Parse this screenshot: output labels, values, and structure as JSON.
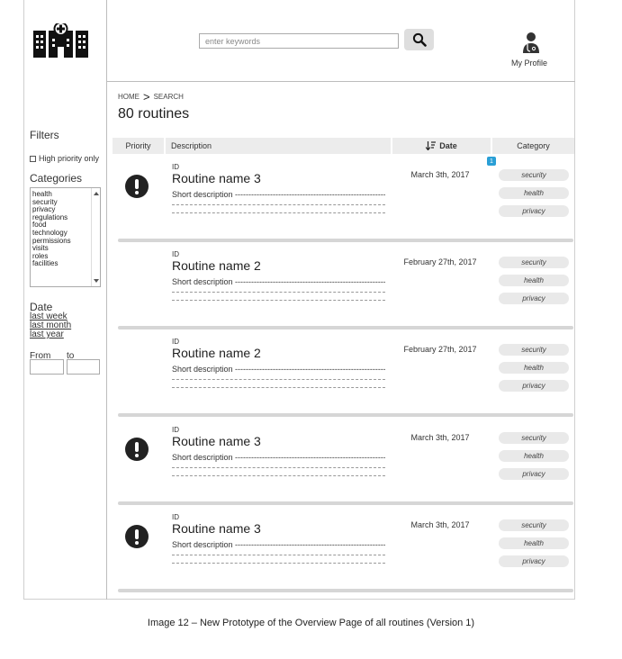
{
  "header": {
    "logo_icon": "hospital-icon",
    "search_placeholder": "enter keywords",
    "search_icon": "search-icon",
    "profile_icon": "doctor-icon",
    "profile_label": "My Profile"
  },
  "sidebar": {
    "filters_title": "Filters",
    "high_priority_label": "High priority only",
    "categories_title": "Categories",
    "categories": [
      "health",
      "security",
      "privacy",
      "regulations",
      "food",
      "technology",
      "permissions",
      "visits",
      "roles",
      "facilities"
    ],
    "date_title": "Date",
    "date_links": [
      "last week",
      "last month",
      "last year"
    ],
    "from_label": "From",
    "to_label": "to"
  },
  "main": {
    "breadcrumb": {
      "home": "HOME",
      "separator": ">",
      "current": "SEARCH"
    },
    "count_label": "80 routines",
    "columns": {
      "priority": "Priority",
      "description": "Description",
      "date": "Date",
      "category": "Category"
    },
    "new_badge": "1",
    "rows": [
      {
        "priority_high": true,
        "id": "ID",
        "name": "Routine name 3",
        "short": "Short description ----------------------------------------------------------------------------",
        "date": "March 3th, 2017",
        "tags": [
          "security",
          "health",
          "privacy"
        ]
      },
      {
        "priority_high": false,
        "id": "ID",
        "name": "Routine name 2",
        "short": "Short description ----------------------------------------------------------------------------",
        "date": "February 27th, 2017",
        "tags": [
          "security",
          "health",
          "privacy"
        ]
      },
      {
        "priority_high": false,
        "id": "ID",
        "name": "Routine name 2",
        "short": "Short description ----------------------------------------------------------------------------",
        "date": "February 27th, 2017",
        "tags": [
          "security",
          "health",
          "privacy"
        ]
      },
      {
        "priority_high": true,
        "id": "ID",
        "name": "Routine name 3",
        "short": "Short description ----------------------------------------------------------------------------",
        "date": "March 3th, 2017",
        "tags": [
          "security",
          "health",
          "privacy"
        ]
      },
      {
        "priority_high": true,
        "id": "ID",
        "name": "Routine name 3",
        "short": "Short description ----------------------------------------------------------------------------",
        "date": "March 3th, 2017",
        "tags": [
          "security",
          "health",
          "privacy"
        ]
      }
    ]
  },
  "caption": "Image 12 – New Prototype of the Overview Page of all routines (Version 1)"
}
